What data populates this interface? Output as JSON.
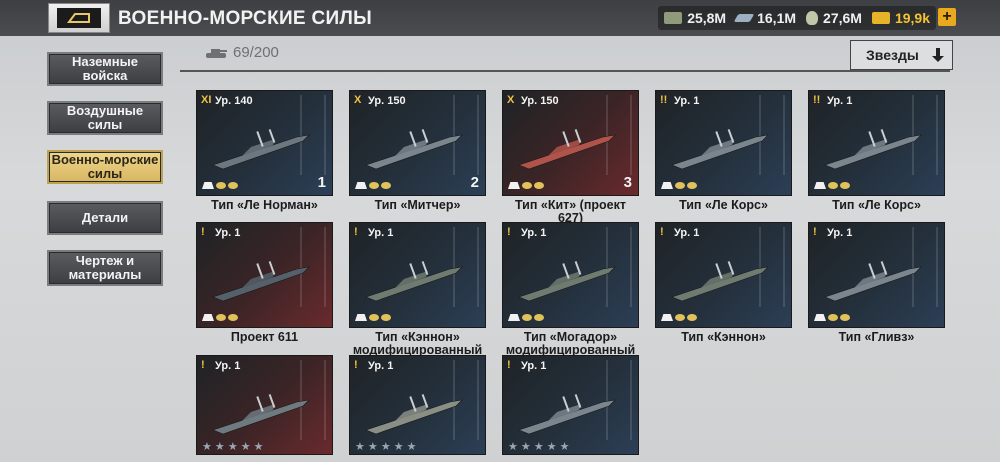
{
  "header": {
    "title": "ВОЕННО-МОРСКИЕ СИЛЫ",
    "back_icon": "back-icon",
    "resources": [
      {
        "name": "cash",
        "value": "25,8M",
        "icon": "money-icon"
      },
      {
        "name": "steel",
        "value": "16,1M",
        "icon": "steel-icon"
      },
      {
        "name": "oil",
        "value": "27,6M",
        "icon": "oil-icon"
      },
      {
        "name": "gold",
        "value": "19,9k",
        "icon": "gold-icon"
      }
    ],
    "plus_label": "+"
  },
  "nav": {
    "items": [
      {
        "label": "Наземные\nвойска",
        "active": false
      },
      {
        "label": "Воздушные\nсилы",
        "active": false
      },
      {
        "label": "Военно-морские\nсилы",
        "active": true
      },
      {
        "label": "Детали",
        "active": false
      },
      {
        "label": "Чертеж и\nматериалы",
        "active": false
      }
    ]
  },
  "filter": {
    "unit_count": "69/200",
    "sort_label": "Звезды",
    "sort_icon": "arrow-down-icon"
  },
  "colors": {
    "accent_gold": "#f0c245",
    "active_nav": "#e6c77a"
  },
  "cards": [
    {
      "tier": "XI",
      "level": "Ур. 140",
      "rank": "1",
      "name": "Тип «Ле Норман»"
    },
    {
      "tier": "X",
      "level": "Ур. 150",
      "rank": "2",
      "name": "Тип «Митчер»"
    },
    {
      "tier": "X",
      "level": "Ур. 150",
      "rank": "3",
      "name": "Тип «Кит» (проект 627)"
    },
    {
      "tier": "!!",
      "level": "Ур. 1",
      "rank": "",
      "name": "Тип «Ле Корс»"
    },
    {
      "tier": "!!",
      "level": "Ур. 1",
      "rank": "",
      "name": "Тип «Ле Корс»"
    },
    {
      "tier": "!",
      "level": "Ур. 1",
      "rank": "",
      "name": "Проект 611"
    },
    {
      "tier": "!",
      "level": "Ур. 1",
      "rank": "",
      "name": "Тип «Кэннон»\nмодифицированный"
    },
    {
      "tier": "!",
      "level": "Ур. 1",
      "rank": "",
      "name": "Тип «Могадор»\nмодифицированный"
    },
    {
      "tier": "!",
      "level": "Ур. 1",
      "rank": "",
      "name": "Тип «Кэннон»"
    },
    {
      "tier": "!",
      "level": "Ур. 1",
      "rank": "",
      "name": "Тип «Гливз»"
    },
    {
      "tier": "!",
      "level": "Ур. 1",
      "rank": "",
      "name": ""
    },
    {
      "tier": "!",
      "level": "Ур. 1",
      "rank": "",
      "name": ""
    },
    {
      "tier": "!",
      "level": "Ур. 1",
      "rank": "",
      "name": ""
    }
  ]
}
